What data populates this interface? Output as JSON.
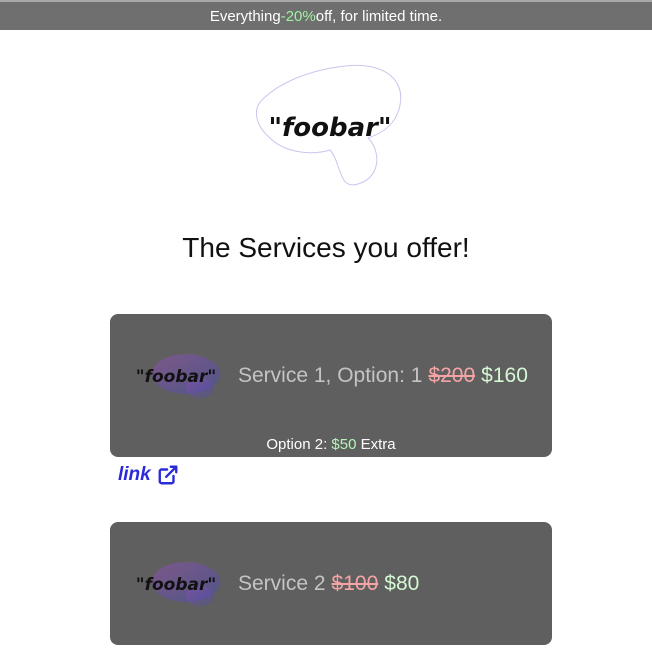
{
  "banner": {
    "prefix": "Everything ",
    "discount": "-20%",
    "suffix": " off, for limited time."
  },
  "logo": {
    "text": "\"foobar\""
  },
  "title": "The Services you offer!",
  "services": [
    {
      "logo_text": "\"foobar\"",
      "name": "Service 1, Option: 1",
      "old_price": "$200",
      "new_price": "$160",
      "extra": {
        "prefix": "Option 2: ",
        "price": "$50",
        "suffix": " Extra"
      }
    },
    {
      "logo_text": "\"foobar\"",
      "name": "Service 2",
      "old_price": "$100",
      "new_price": "$80"
    }
  ],
  "link": {
    "label": "link",
    "icon": "external-link-icon"
  },
  "colors": {
    "banner_bg": "#6f6f6f",
    "discount": "#9ef29e",
    "card_bg": "#5f5f5f",
    "old_price": "#f4a4a4",
    "new_price": "#d4f8d4",
    "link": "#2a2ad8"
  }
}
